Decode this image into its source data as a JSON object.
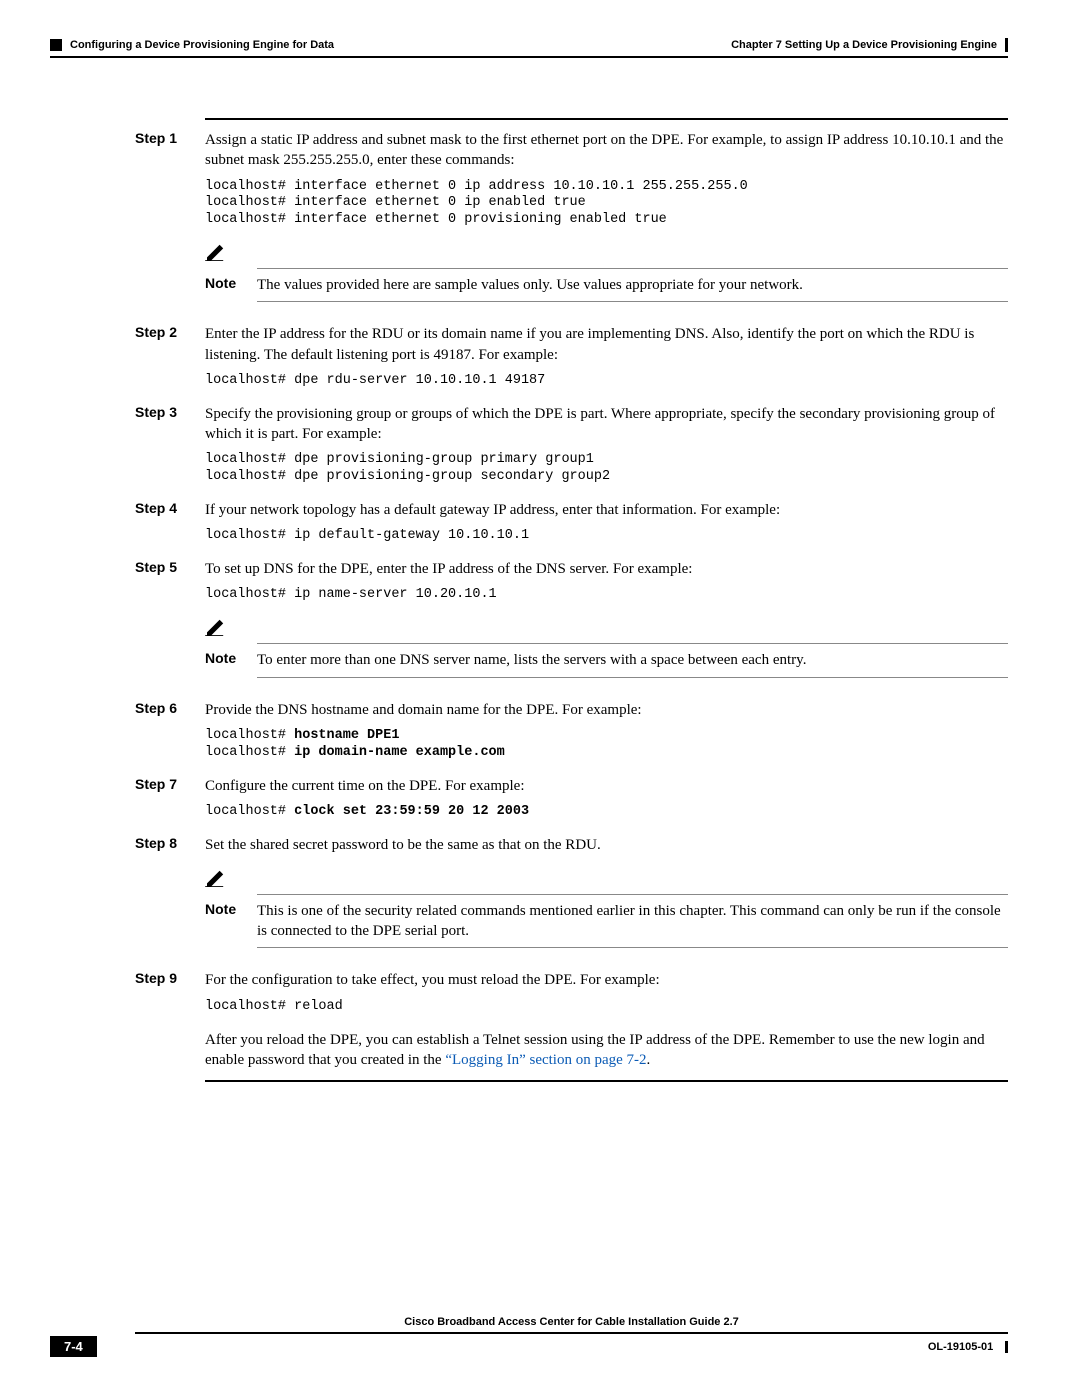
{
  "header": {
    "section": "Configuring a Device Provisioning Engine for Data",
    "chapter": "Chapter 7      Setting Up a Device Provisioning Engine"
  },
  "steps": {
    "s1": {
      "label": "Step 1",
      "text": "Assign a static IP address and subnet mask to the first ethernet port on the DPE. For example, to assign IP address 10.10.10.1 and the subnet mask 255.255.255.0, enter these commands:",
      "code": "localhost# interface ethernet 0 ip address 10.10.10.1 255.255.255.0\nlocalhost# interface ethernet 0 ip enabled true\nlocalhost# interface ethernet 0 provisioning enabled true"
    },
    "note1": {
      "label": "Note",
      "text": "The values provided here are sample values only. Use values appropriate for your network."
    },
    "s2": {
      "label": "Step 2",
      "text": "Enter the IP address for the RDU or its domain name if you are implementing DNS. Also, identify the port on which the RDU is listening. The default listening port is 49187. For example:",
      "code": "localhost# dpe rdu-server 10.10.10.1 49187"
    },
    "s3": {
      "label": "Step 3",
      "text": "Specify the provisioning group or groups of which the DPE is part. Where appropriate, specify the secondary provisioning group of which it is part. For example:",
      "code": "localhost# dpe provisioning-group primary group1\nlocalhost# dpe provisioning-group secondary group2"
    },
    "s4": {
      "label": "Step 4",
      "text": "If your network topology has a default gateway IP address, enter that information. For example:",
      "code": "localhost# ip default-gateway 10.10.10.1"
    },
    "s5": {
      "label": "Step 5",
      "text": "To set up DNS for the DPE, enter the IP address of the DNS server. For example:",
      "code": "localhost# ip name-server 10.20.10.1"
    },
    "note2": {
      "label": "Note",
      "text": "To enter more than one DNS server name, lists the servers with a space between each entry."
    },
    "s6": {
      "label": "Step 6",
      "text": "Provide the DNS hostname and domain name for the DPE. For example:",
      "code_pre": "localhost# ",
      "code_bold1": "hostname DPE1",
      "code_pre2": "localhost# ",
      "code_bold2": "ip domain-name example.com"
    },
    "s7": {
      "label": "Step 7",
      "text": "Configure the current time on the DPE. For example:",
      "code_pre": "localhost# ",
      "code_bold": "clock set 23:59:59 20 12 2003"
    },
    "s8": {
      "label": "Step 8",
      "text": "Set the shared secret password to be the same as that on the RDU."
    },
    "note3": {
      "label": "Note",
      "text": "This is one of the security related commands mentioned earlier in this chapter. This command can only be run if the console is connected to the DPE serial port."
    },
    "s9": {
      "label": "Step 9",
      "text": "For the configuration to take effect, you must reload the DPE. For example:",
      "code": "localhost# reload"
    },
    "after": {
      "text1": "After you reload the DPE, you can establish a Telnet session using the IP address of the DPE. Remember to use the new login and enable password that you created in the ",
      "link": "“Logging In” section on page 7-2",
      "text2": "."
    }
  },
  "footer": {
    "guide": "Cisco Broadband Access Center for Cable Installation Guide 2.7",
    "page": "7-4",
    "doc": "OL-19105-01"
  }
}
